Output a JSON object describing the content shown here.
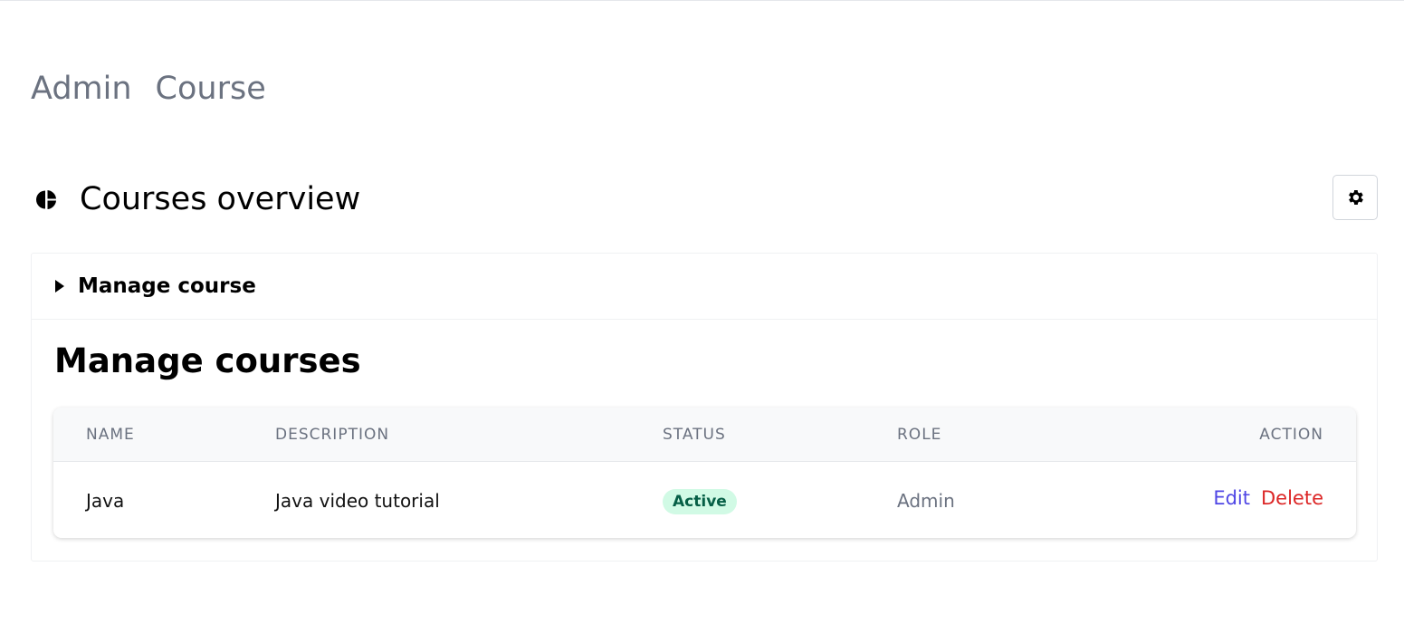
{
  "breadcrumb": [
    "Admin",
    "Course"
  ],
  "header": {
    "title": "Courses overview",
    "icon": "pie-chart-icon",
    "settings_icon": "gear-icon"
  },
  "manage_section": {
    "summary_label": "Manage course",
    "heading": "Manage courses"
  },
  "table": {
    "columns": [
      "NAME",
      "DESCRIPTION",
      "STATUS",
      "ROLE",
      "ACTION"
    ],
    "rows": [
      {
        "name": "Java",
        "description": "Java video tutorial",
        "status": "Active",
        "role": "Admin",
        "edit_label": "Edit",
        "delete_label": "Delete"
      }
    ]
  },
  "colors": {
    "accent": "#4f46e5",
    "danger": "#dc2626",
    "status_active_bg": "#d1fae5",
    "status_active_text": "#065f46"
  }
}
